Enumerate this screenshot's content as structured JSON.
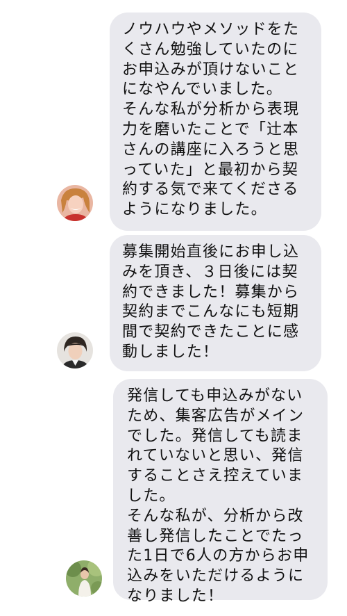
{
  "messages": [
    {
      "avatar_icon": "user-avatar-icon",
      "text": "ノウハウやメソッドをたくさん勉強していたのにお申込みが頂けないことになやんでいました。\nそんな私が分析から表現力を磨いたことで「辻本さんの講座に入ろうと思っていた」と最初から契約する気で来てくださるようになりました。"
    },
    {
      "avatar_icon": "user-avatar-icon",
      "text": "募集開始直後にお申し込みを頂き、３日後には契約できました！募集から契約までこんなにも短期間で契約できたことに感動しました！"
    },
    {
      "avatar_icon": "user-avatar-icon",
      "text": "発信しても申込みがないため、集客広告がメインでした。発信しても読まれていないと思い、発信することさえ控えていました。\nそんな私が、分析から改善し発信したことでたった1日で6人の方からお申込みをいただけるようになりました！"
    }
  ],
  "colors": {
    "bubble": "#e9e9ee",
    "text": "#111111",
    "background": "#ffffff"
  }
}
